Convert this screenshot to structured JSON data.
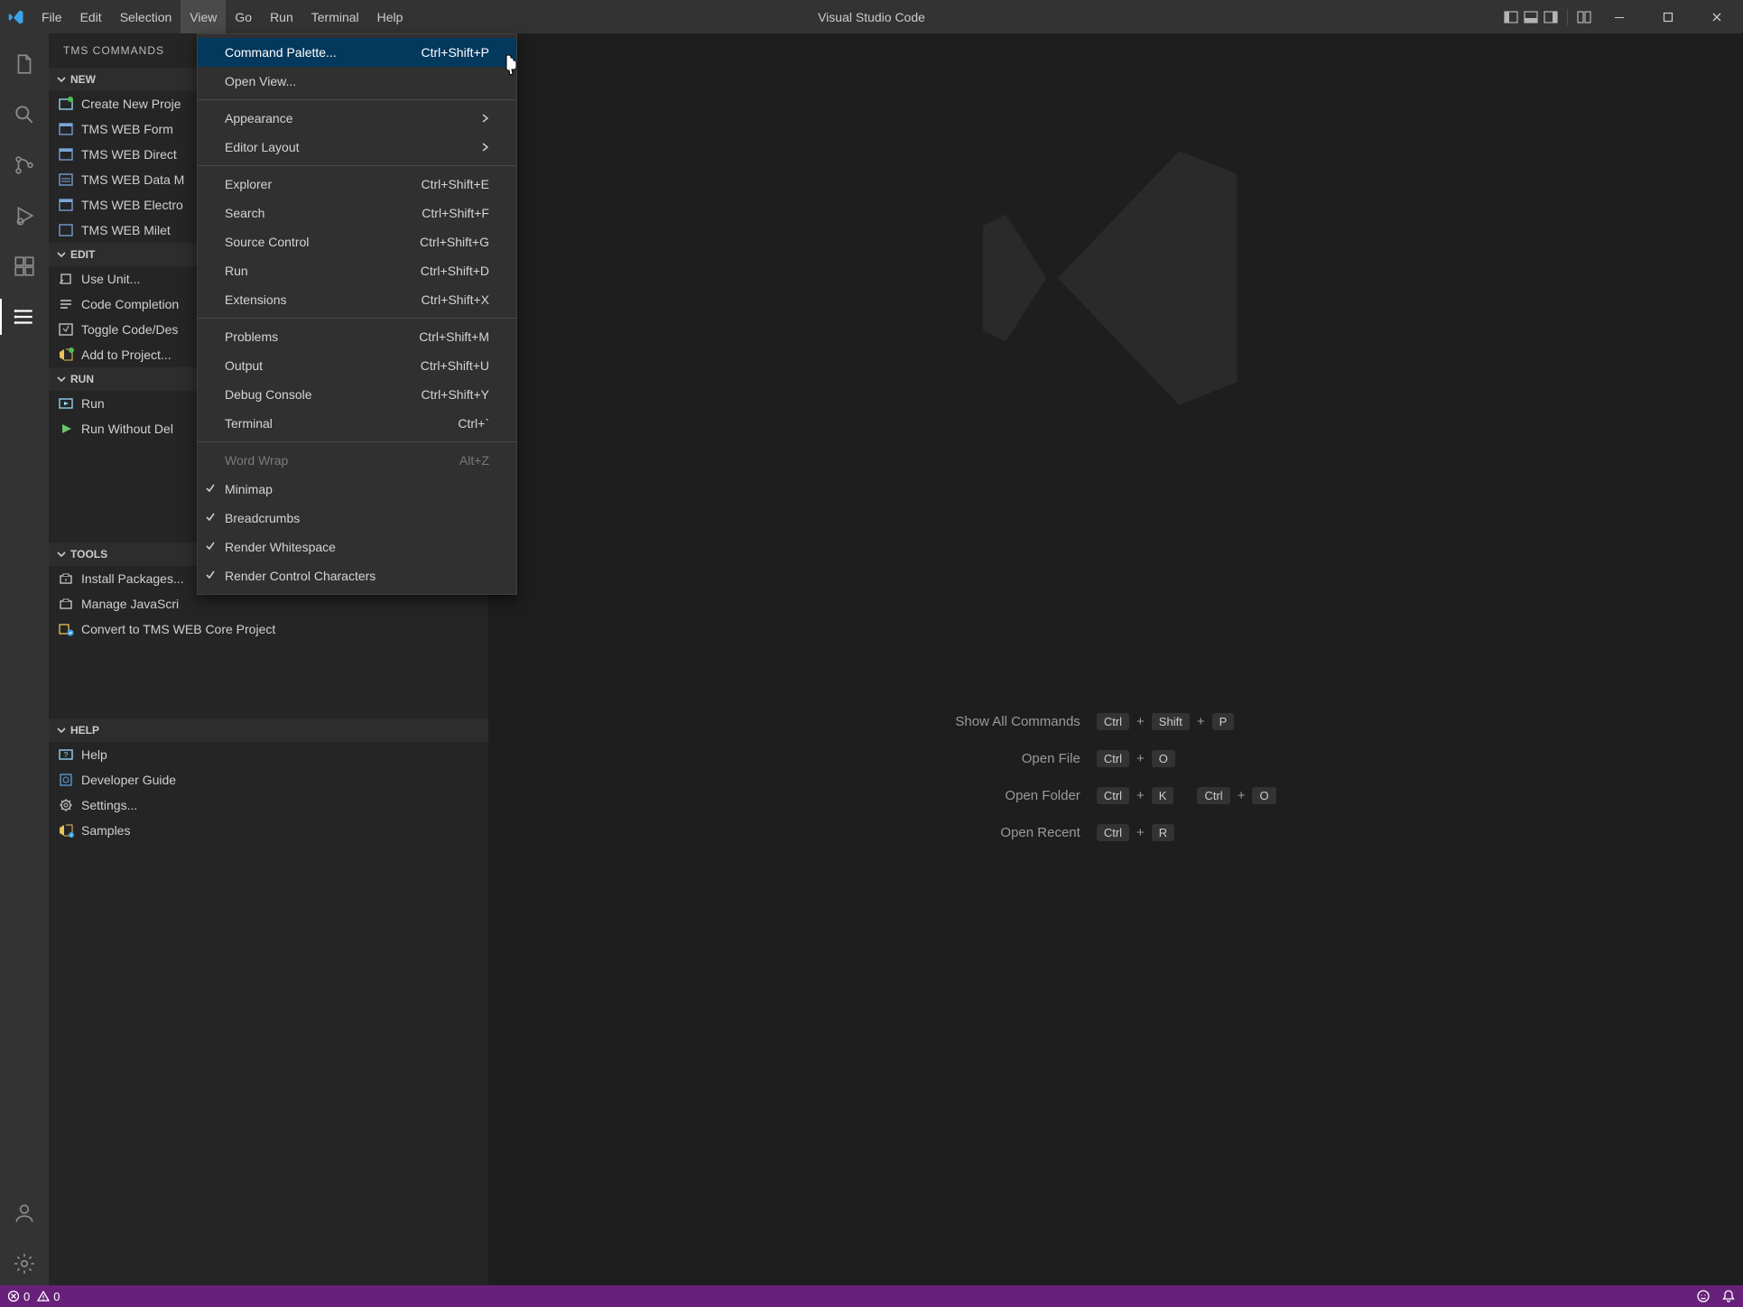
{
  "app": {
    "title": "Visual Studio Code"
  },
  "menubar": [
    "File",
    "Edit",
    "Selection",
    "View",
    "Go",
    "Run",
    "Terminal",
    "Help"
  ],
  "menubar_active": "View",
  "sidebar": {
    "title": "TMS COMMANDS",
    "sections": [
      {
        "name": "NEW",
        "items": [
          "Create New Proje",
          "TMS WEB Form",
          "TMS WEB Direct",
          "TMS WEB Data M",
          "TMS WEB Electro",
          "TMS WEB Milet"
        ]
      },
      {
        "name": "EDIT",
        "items": [
          "Use Unit...",
          "Code Completion",
          "Toggle Code/Des",
          "Add to Project..."
        ]
      },
      {
        "name": "RUN",
        "items": [
          "Run",
          "Run Without Del"
        ]
      },
      {
        "name": "TOOLS",
        "items": [
          "Install Packages...",
          "Manage JavaScri",
          "Convert to TMS WEB Core Project"
        ]
      },
      {
        "name": "HELP",
        "items": [
          "Help",
          "Developer Guide",
          "Settings...",
          "Samples"
        ]
      }
    ]
  },
  "view_menu": {
    "groups": [
      [
        {
          "label": "Command Palette...",
          "shortcut": "Ctrl+Shift+P",
          "highlighted": true
        },
        {
          "label": "Open View..."
        }
      ],
      [
        {
          "label": "Appearance",
          "submenu": true
        },
        {
          "label": "Editor Layout",
          "submenu": true
        }
      ],
      [
        {
          "label": "Explorer",
          "shortcut": "Ctrl+Shift+E"
        },
        {
          "label": "Search",
          "shortcut": "Ctrl+Shift+F"
        },
        {
          "label": "Source Control",
          "shortcut": "Ctrl+Shift+G"
        },
        {
          "label": "Run",
          "shortcut": "Ctrl+Shift+D"
        },
        {
          "label": "Extensions",
          "shortcut": "Ctrl+Shift+X"
        }
      ],
      [
        {
          "label": "Problems",
          "shortcut": "Ctrl+Shift+M"
        },
        {
          "label": "Output",
          "shortcut": "Ctrl+Shift+U"
        },
        {
          "label": "Debug Console",
          "shortcut": "Ctrl+Shift+Y"
        },
        {
          "label": "Terminal",
          "shortcut": "Ctrl+`"
        }
      ],
      [
        {
          "label": "Word Wrap",
          "shortcut": "Alt+Z",
          "disabled": true
        },
        {
          "label": "Minimap",
          "checked": true
        },
        {
          "label": "Breadcrumbs",
          "checked": true
        },
        {
          "label": "Render Whitespace",
          "checked": true
        },
        {
          "label": "Render Control Characters",
          "checked": true
        }
      ]
    ]
  },
  "welcome": {
    "shortcuts": [
      {
        "label": "Show All Commands",
        "keys": [
          [
            "Ctrl",
            "Shift",
            "P"
          ]
        ]
      },
      {
        "label": "Open File",
        "keys": [
          [
            "Ctrl",
            "O"
          ]
        ]
      },
      {
        "label": "Open Folder",
        "keys": [
          [
            "Ctrl",
            "K"
          ],
          [
            "Ctrl",
            "O"
          ]
        ]
      },
      {
        "label": "Open Recent",
        "keys": [
          [
            "Ctrl",
            "R"
          ]
        ]
      }
    ]
  },
  "statusbar": {
    "errors": "0",
    "warnings": "0"
  }
}
